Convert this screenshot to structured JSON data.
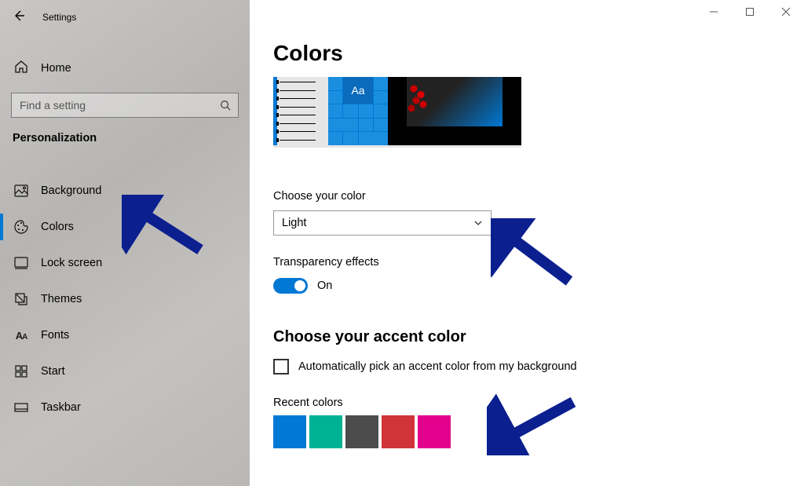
{
  "window": {
    "app_title": "Settings",
    "controls": {
      "minimize": "min",
      "maximize": "max",
      "close": "close"
    }
  },
  "sidebar": {
    "home_label": "Home",
    "search_placeholder": "Find a setting",
    "section_label": "Personalization",
    "items": [
      {
        "label": "Background",
        "icon": "image-icon",
        "active": false
      },
      {
        "label": "Colors",
        "icon": "palette-icon",
        "active": true
      },
      {
        "label": "Lock screen",
        "icon": "lock-screen-icon",
        "active": false
      },
      {
        "label": "Themes",
        "icon": "themes-icon",
        "active": false
      },
      {
        "label": "Fonts",
        "icon": "fonts-icon",
        "active": false
      },
      {
        "label": "Start",
        "icon": "start-icon",
        "active": false
      },
      {
        "label": "Taskbar",
        "icon": "taskbar-icon",
        "active": false
      }
    ]
  },
  "main": {
    "title": "Colors",
    "preview_tile_text": "Aa",
    "choose_color": {
      "label": "Choose your color",
      "selected": "Light"
    },
    "transparency": {
      "label": "Transparency effects",
      "state_text": "On",
      "on": true
    },
    "accent": {
      "title": "Choose your accent color",
      "auto_checkbox_label": "Automatically pick an accent color from my background",
      "auto_checked": false,
      "recent_label": "Recent colors",
      "recent_colors": [
        "#0078d4",
        "#00b294",
        "#4c4c4c",
        "#d13438",
        "#e3008c"
      ]
    }
  },
  "annotations": {
    "arrow1_target": "sidebar-item-colors",
    "arrow2_target": "color-mode-dropdown",
    "arrow3_target": "recent-colors"
  }
}
